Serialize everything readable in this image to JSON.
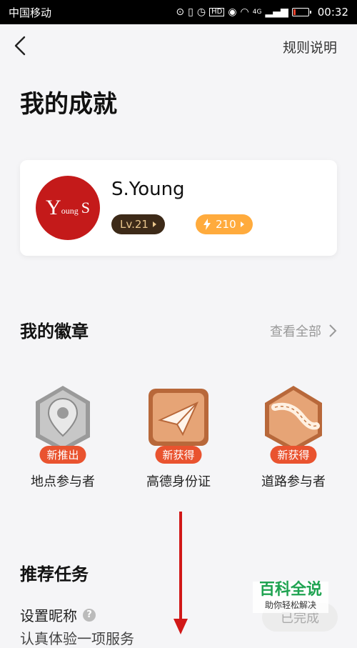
{
  "status_bar": {
    "carrier": "中国移动",
    "network": "4G",
    "time": "00:32",
    "icons": [
      "location-icon",
      "vibrate-icon",
      "alarm-icon",
      "hd-icon",
      "eye-icon",
      "wifi-icon",
      "signal-icon",
      "battery-icon"
    ]
  },
  "nav": {
    "back_icon": "back-chevron-icon",
    "rules_label": "规则说明"
  },
  "page_title": "我的成就",
  "profile": {
    "avatar_text_big": "Y",
    "avatar_text_small": "oung",
    "avatar_text_end": "S",
    "username": "S.Young",
    "level": "Lv.21",
    "points": "210",
    "level_color": "#3d2a18",
    "points_color": "#ffab3d"
  },
  "badges_section": {
    "title": "我的徽章",
    "view_all": "查看全部",
    "items": [
      {
        "tag": "新推出",
        "name": "地点参与者",
        "icon": "map-pin-badge-icon"
      },
      {
        "tag": "新获得",
        "name": "高德身份证",
        "icon": "paper-plane-badge-icon"
      },
      {
        "tag": "新获得",
        "name": "道路参与者",
        "icon": "road-badge-icon"
      }
    ],
    "tag_color": "#e9532f"
  },
  "tasks_section": {
    "title": "推荐任务",
    "task1": "设置昵称",
    "task1_button": "已完成",
    "task2": "认真体验一项服务"
  },
  "watermark": {
    "title": "百科全说",
    "subtitle": "助你轻松解决"
  }
}
